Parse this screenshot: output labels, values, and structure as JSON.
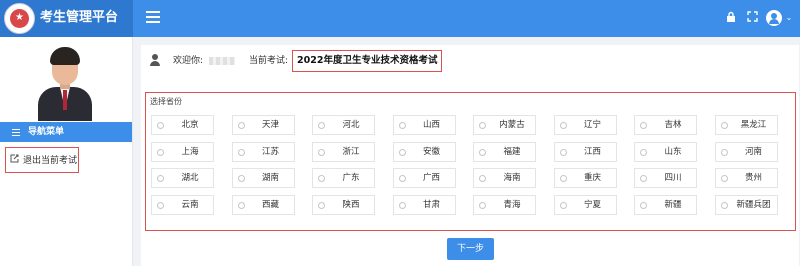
{
  "app": {
    "title": "考生管理平台"
  },
  "sidebar": {
    "nav_header": "导航菜单",
    "items": [
      {
        "label": "退出当前考试"
      }
    ]
  },
  "welcome": {
    "greeting_label": "欢迎你:",
    "exam_label": "当前考试:",
    "exam_name": "2022年度卫生专业技术资格考试"
  },
  "province_panel": {
    "title": "选择省份",
    "provinces": [
      "北京",
      "天津",
      "河北",
      "山西",
      "内蒙古",
      "辽宁",
      "吉林",
      "黑龙江",
      "上海",
      "江苏",
      "浙江",
      "安徽",
      "福建",
      "江西",
      "山东",
      "河南",
      "湖北",
      "湖南",
      "广东",
      "广西",
      "海南",
      "重庆",
      "四川",
      "贵州",
      "云南",
      "西藏",
      "陕西",
      "甘肃",
      "青海",
      "宁夏",
      "新疆",
      "新疆兵团"
    ]
  },
  "actions": {
    "next_label": "下一步"
  },
  "icons": {
    "menu": "hamburger-icon",
    "lock": "lock-icon",
    "fullscreen": "fullscreen-icon",
    "user": "user-avatar-icon",
    "exit": "exit-icon",
    "person": "person-icon"
  },
  "colors": {
    "primary": "#3c8ee8",
    "primary_dark": "#2f78cf",
    "highlight_border": "#d9534f"
  }
}
